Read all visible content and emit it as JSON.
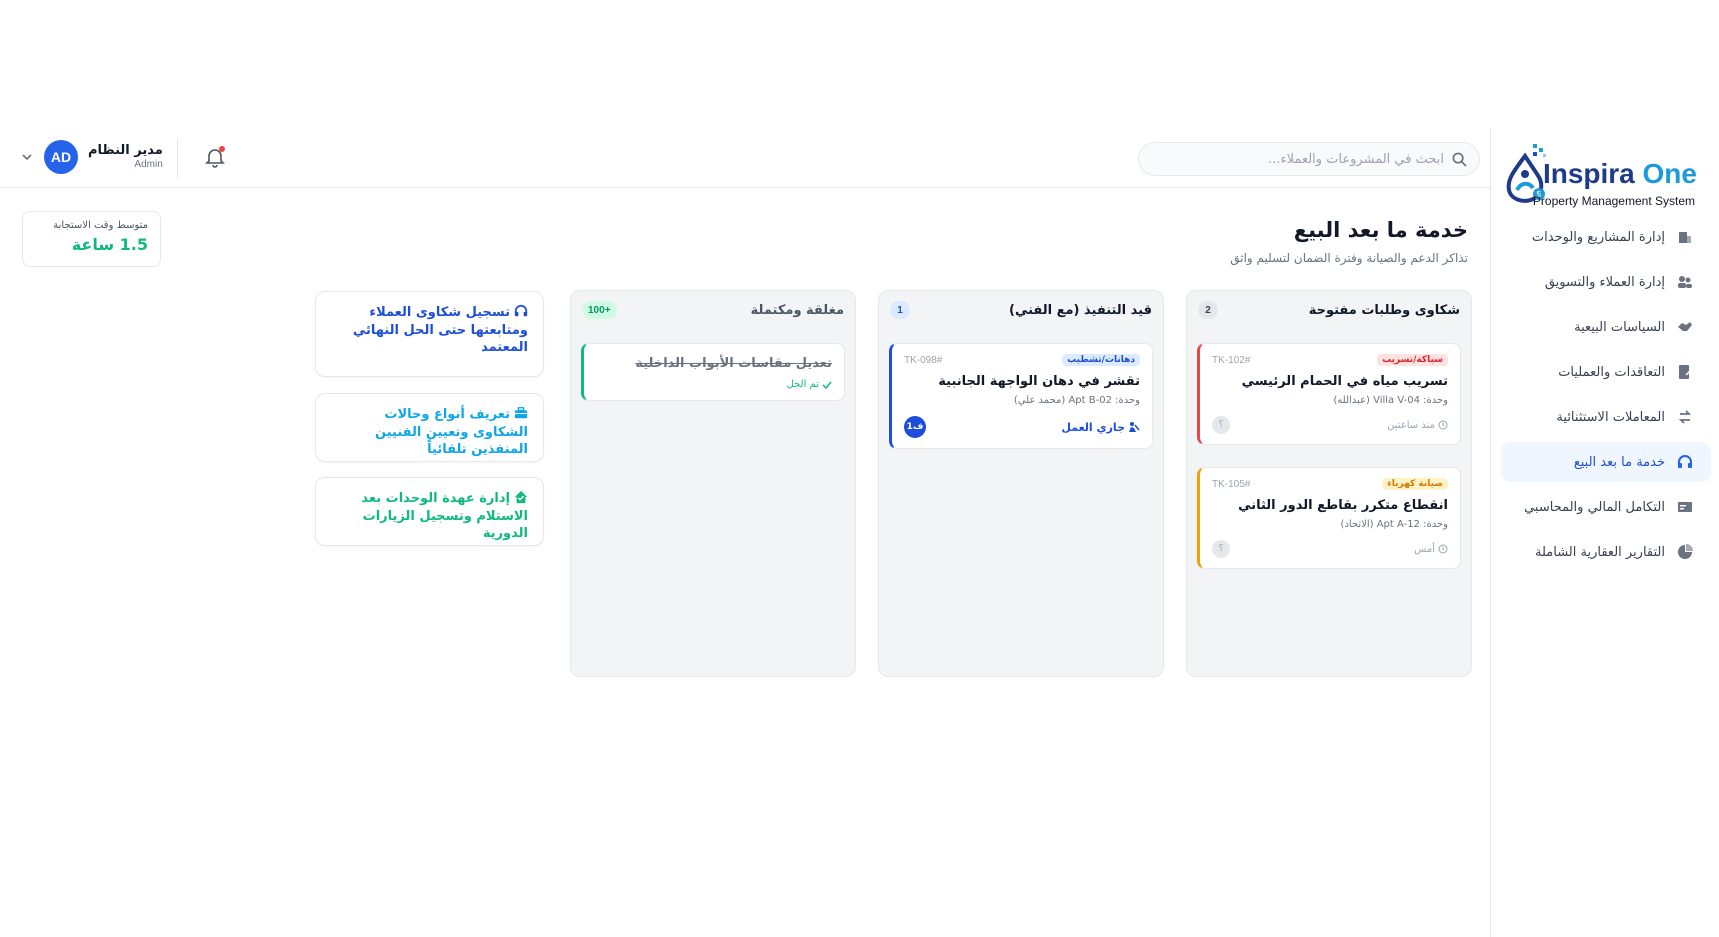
{
  "brand": {
    "name_main": "Inspira",
    "name_accent": "One",
    "tagline": "Property Management System"
  },
  "sidebar": {
    "items": [
      {
        "label": "إدارة المشاريع والوحدات",
        "icon": "building-icon",
        "active": false
      },
      {
        "label": "إدارة العملاء والتسويق",
        "icon": "users-icon",
        "active": false
      },
      {
        "label": "السياسات البيعية",
        "icon": "handshake-icon",
        "active": false
      },
      {
        "label": "التعاقدات والعمليات",
        "icon": "contract-icon",
        "active": false
      },
      {
        "label": "المعاملات الاستثنائية",
        "icon": "exchange-icon",
        "active": false
      },
      {
        "label": "خدمة ما بعد البيع",
        "icon": "headset-icon",
        "active": true
      },
      {
        "label": "التكامل المالي والمحاسبي",
        "icon": "finance-icon",
        "active": false
      },
      {
        "label": "التقارير العقارية الشاملة",
        "icon": "pie-chart-icon",
        "active": false
      }
    ]
  },
  "header": {
    "search_placeholder": "ابحث في المشروعات والعملاء...",
    "user_name": "مدير النظام",
    "user_role": "Admin",
    "user_initials": "AD"
  },
  "page": {
    "title": "خدمة ما بعد البيع",
    "subtitle": "تذاكر الدعم والصيانة وفترة الضمان لتسليم واثق"
  },
  "stat": {
    "label": "متوسط وقت الاستجابة",
    "value": "1.5 ساعة"
  },
  "columns": [
    {
      "title": "شكاوى وطلبات مفتوحة",
      "count": "2",
      "cards": [
        {
          "tag": "سباكة/تسريب",
          "id": "TK-102#",
          "title": "تسريب مياه في الحمام الرئيسي",
          "unit": "وحدة: Villa V-04 (عبدالله)",
          "time": "منذ ساعتين",
          "avatar": "؟"
        },
        {
          "tag": "صيانة كهرباء",
          "id": "TK-105#",
          "title": "انقطاع متكرر بقاطع الدور الثاني",
          "unit": "وحدة: Apt A-12 (الاتحاد)",
          "time": "أمس",
          "avatar": "؟"
        }
      ]
    },
    {
      "title": "قيد التنفيذ (مع الفني)",
      "count": "1",
      "cards": [
        {
          "tag": "دهانات/تشطيب",
          "id": "TK-098#",
          "title": "تقشر في دهان الواجهة الجانبية",
          "unit": "وحدة: Apt B-02 (محمد علي)",
          "status": "جاري العمل",
          "avatar": "ف1"
        }
      ]
    },
    {
      "title": "مغلقة ومكتملة",
      "count": "+100",
      "cards": [
        {
          "title": "تعديل مقاسات الأبواب الداخلية",
          "status": "تم الحل"
        }
      ]
    }
  ],
  "features": [
    {
      "text": "تسجيل شكاوى العملاء ومتابعتها حتى الحل النهائي المعتمد",
      "icon": "headset-icon",
      "color": "#1d4ed8"
    },
    {
      "text": "تعريف أنواع وحالات الشكاوى وتعيين الفنيين المنفذين تلقائياً",
      "icon": "toolbox-icon",
      "color": "#0ea5e9"
    },
    {
      "text": "إدارة عهدة الوحدات بعد الاستلام وتسجيل الزيارات الدورية",
      "icon": "home-check-icon",
      "color": "#10b981"
    }
  ],
  "colors": {
    "accent": "#2563eb",
    "open": "#ef4444",
    "electric": "#f59e0b",
    "progress": "#1d4ed8",
    "done": "#10b981"
  }
}
